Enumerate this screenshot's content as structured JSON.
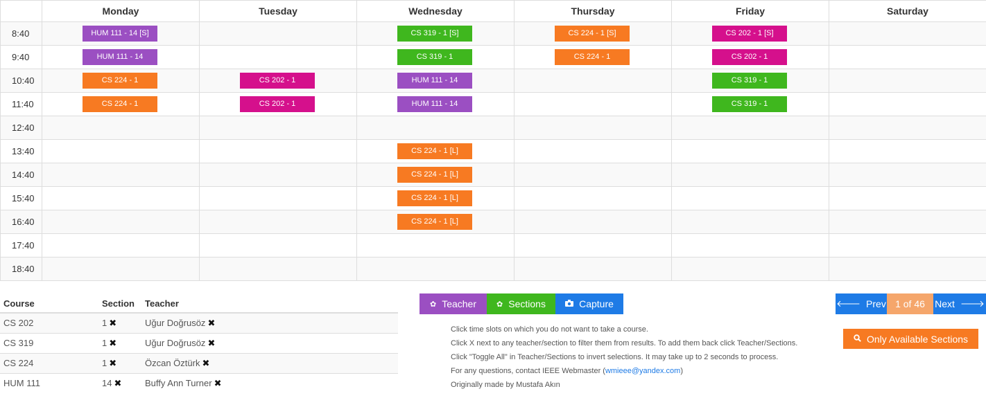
{
  "schedule": {
    "days": [
      "Monday",
      "Tuesday",
      "Wednesday",
      "Thursday",
      "Friday",
      "Saturday"
    ],
    "times": [
      "8:40",
      "9:40",
      "10:40",
      "11:40",
      "12:40",
      "13:40",
      "14:40",
      "15:40",
      "16:40",
      "17:40",
      "18:40"
    ],
    "blocks": [
      {
        "label": "HUM 111 - 14 [S]",
        "day": 0,
        "slot": 0,
        "color": "#9b4fc2"
      },
      {
        "label": "HUM 111 - 14",
        "day": 0,
        "slot": 1,
        "color": "#9b4fc2"
      },
      {
        "label": "CS 224 - 1",
        "day": 0,
        "slot": 2,
        "color": "#f77a22"
      },
      {
        "label": "CS 224 - 1",
        "day": 0,
        "slot": 3,
        "color": "#f77a22"
      },
      {
        "label": "CS 202 - 1",
        "day": 1,
        "slot": 2,
        "color": "#d5108c"
      },
      {
        "label": "CS 202 - 1",
        "day": 1,
        "slot": 3,
        "color": "#d5108c"
      },
      {
        "label": "CS 319 - 1 [S]",
        "day": 2,
        "slot": 0,
        "color": "#3fb71e"
      },
      {
        "label": "CS 319 - 1",
        "day": 2,
        "slot": 1,
        "color": "#3fb71e"
      },
      {
        "label": "HUM 111 - 14",
        "day": 2,
        "slot": 2,
        "color": "#9b4fc2"
      },
      {
        "label": "HUM 111 - 14",
        "day": 2,
        "slot": 3,
        "color": "#9b4fc2"
      },
      {
        "label": "CS 224 - 1 [L]",
        "day": 2,
        "slot": 5,
        "color": "#f77a22"
      },
      {
        "label": "CS 224 - 1 [L]",
        "day": 2,
        "slot": 6,
        "color": "#f77a22"
      },
      {
        "label": "CS 224 - 1 [L]",
        "day": 2,
        "slot": 7,
        "color": "#f77a22"
      },
      {
        "label": "CS 224 - 1 [L]",
        "day": 2,
        "slot": 8,
        "color": "#f77a22"
      },
      {
        "label": "CS 224 - 1 [S]",
        "day": 3,
        "slot": 0,
        "color": "#f77a22"
      },
      {
        "label": "CS 224 - 1",
        "day": 3,
        "slot": 1,
        "color": "#f77a22"
      },
      {
        "label": "CS 202 - 1 [S]",
        "day": 4,
        "slot": 0,
        "color": "#d5108c"
      },
      {
        "label": "CS 202 - 1",
        "day": 4,
        "slot": 1,
        "color": "#d5108c"
      },
      {
        "label": "CS 319 - 1",
        "day": 4,
        "slot": 2,
        "color": "#3fb71e"
      },
      {
        "label": "CS 319 - 1",
        "day": 4,
        "slot": 3,
        "color": "#3fb71e"
      }
    ]
  },
  "courses": {
    "headers": {
      "course": "Course",
      "section": "Section",
      "teacher": "Teacher"
    },
    "rows": [
      {
        "course": "CS 202",
        "section": "1",
        "teacher": "Uğur Doğrusöz"
      },
      {
        "course": "CS 319",
        "section": "1",
        "teacher": "Uğur Doğrusöz"
      },
      {
        "course": "CS 224",
        "section": "1",
        "teacher": "Özcan Öztürk"
      },
      {
        "course": "HUM 111",
        "section": "14",
        "teacher": "Buffy Ann Turner"
      }
    ],
    "remove_glyph": "✖"
  },
  "toolbar": {
    "teacher_label": "Teacher",
    "sections_label": "Sections",
    "capture_label": "Capture",
    "teacher_color": "#9b4fc2",
    "sections_color": "#3fb71e",
    "capture_color": "#1e7be6"
  },
  "info": {
    "line1": "Click time slots on which you do not want to take a course.",
    "line2": "Click X next to any teacher/section to filter them from results. To add them back click Teacher/Sections.",
    "line3": "Click \"Toggle All\" in Teacher/Sections to invert selections. It may take up to 2 seconds to process.",
    "line4_prefix": "For any questions, contact IEEE Webmaster (",
    "line4_email": "wmieee@yandex.com",
    "line4_suffix": ")",
    "line5": "Originally made by Mustafa Akın"
  },
  "pager": {
    "prev_label": "Prev",
    "page_text": "1 of 46",
    "next_label": "Next",
    "blue": "#1e7be6",
    "page_color": "#f5a66b"
  },
  "filter": {
    "only_available_label": "Only Available Sections",
    "color": "#f77a22"
  }
}
